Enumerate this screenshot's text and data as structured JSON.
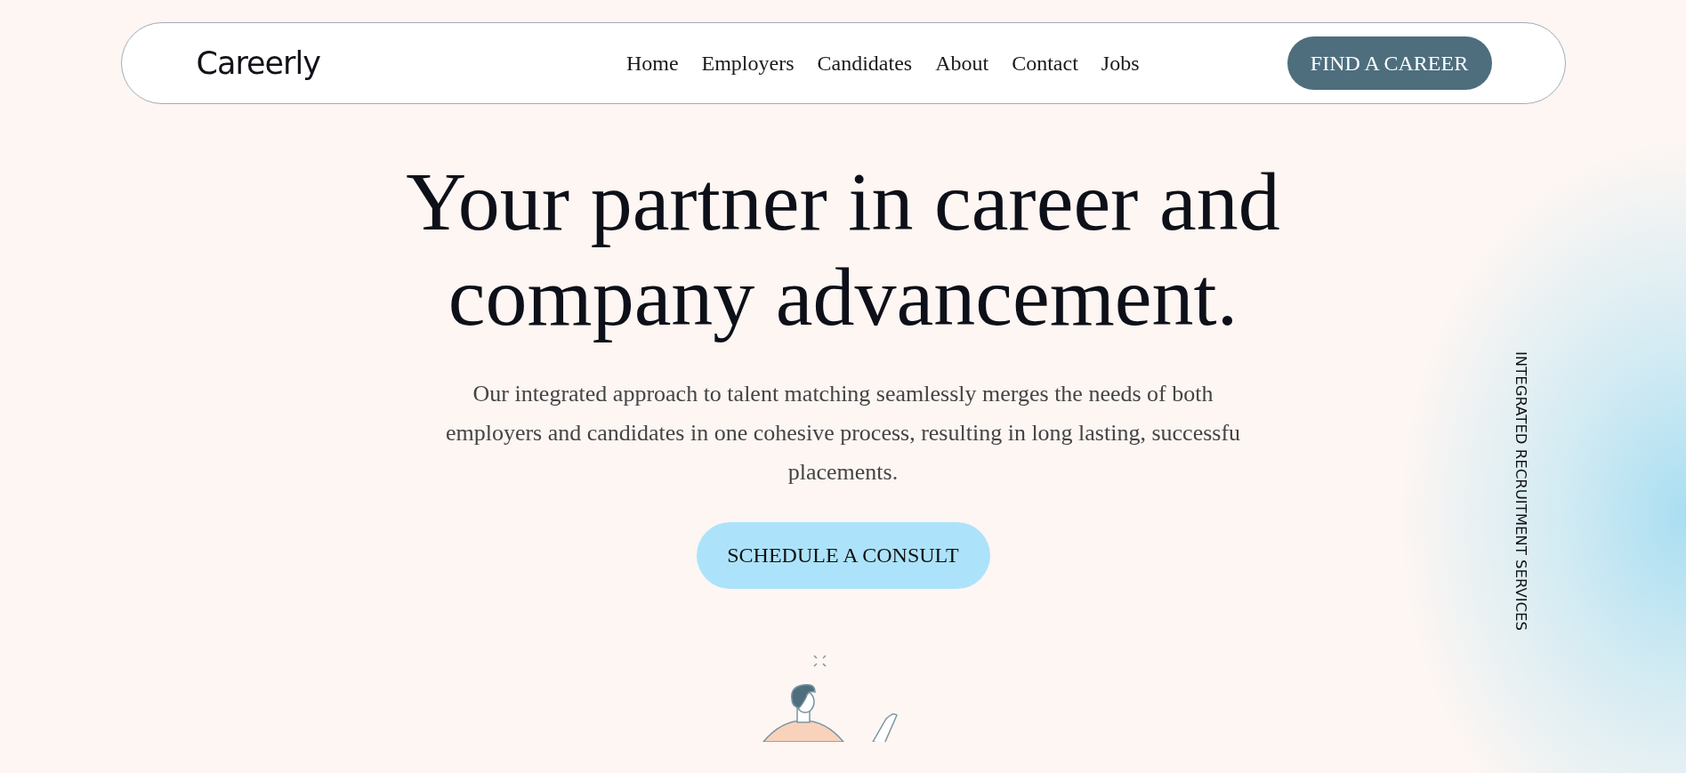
{
  "nav": {
    "logo": "Careerly",
    "links": [
      {
        "label": "Home"
      },
      {
        "label": "Employers"
      },
      {
        "label": "Candidates"
      },
      {
        "label": "About"
      },
      {
        "label": "Contact"
      },
      {
        "label": "Jobs"
      }
    ],
    "cta": "FIND A CAREER"
  },
  "hero": {
    "heading": "Your partner in career and\ncompany advancement.",
    "text": "Our integrated approach to talent matching seamlessly merges the needs of both\nemployers and candidates in one cohesive process, resulting in long lasting, successfu\nplacements.",
    "button": "SCHEDULE A CONSULT"
  },
  "side_label": "INTEGRATED RECRUITMENT SERVICES"
}
